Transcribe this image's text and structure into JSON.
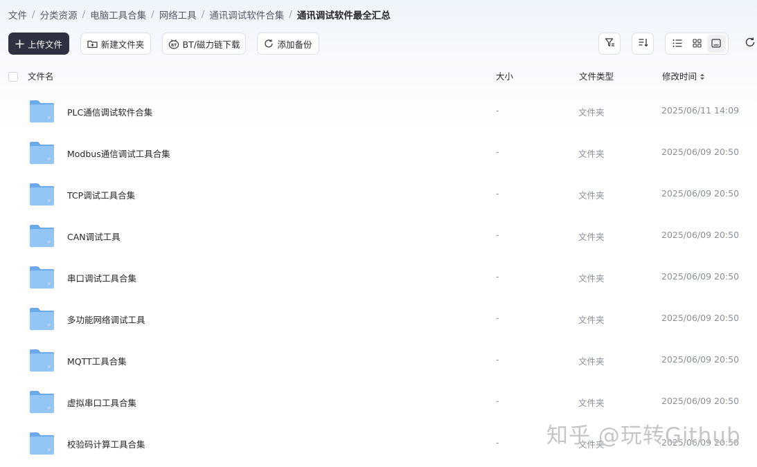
{
  "breadcrumb": [
    "文件",
    "分类资源",
    "电脑工具合集",
    "网络工具",
    "通讯调试软件合集",
    "通讯调试软件最全汇总"
  ],
  "toolbar": {
    "upload_label": "上传文件",
    "new_folder_label": "新建文件夹",
    "bt_label": "BT/磁力链下载",
    "backup_label": "添加备份",
    "icons": [
      "plus-icon",
      "new-folder-icon",
      "bt-icon",
      "sync-icon",
      "filter-icon",
      "sort-icon",
      "list-view-icon",
      "grid-view-icon",
      "thumbnail-view-icon",
      "refresh-icon"
    ]
  },
  "table": {
    "headers": {
      "name": "文件名",
      "size": "大小",
      "type": "文件类型",
      "time": "修改时间"
    },
    "rows": [
      {
        "name": "PLC通信调试软件合集",
        "size": "-",
        "type": "文件夹",
        "time": "2025/06/11 14:09"
      },
      {
        "name": "Modbus通信调试工具合集",
        "size": "-",
        "type": "文件夹",
        "time": "2025/06/09 20:50"
      },
      {
        "name": "TCP调试工具合集",
        "size": "-",
        "type": "文件夹",
        "time": "2025/06/09 20:50"
      },
      {
        "name": "CAN调试工具",
        "size": "-",
        "type": "文件夹",
        "time": "2025/06/09 20:50"
      },
      {
        "name": "串口调试工具合集",
        "size": "-",
        "type": "文件夹",
        "time": "2025/06/09 20:50"
      },
      {
        "name": "多功能网络调试工具",
        "size": "-",
        "type": "文件夹",
        "time": "2025/06/09 20:50"
      },
      {
        "name": "MQTT工具合集",
        "size": "-",
        "type": "文件夹",
        "time": "2025/06/09 20:50"
      },
      {
        "name": "虚拟串口工具合集",
        "size": "-",
        "type": "文件夹",
        "time": "2025/06/09 20:50"
      },
      {
        "name": "校验码计算工具合集",
        "size": "-",
        "type": "文件夹",
        "time": "2025/06/09 20:50"
      }
    ]
  },
  "watermark": "知乎 @玩转Github",
  "colors": {
    "primary_button": "#2e3140",
    "folder": "#7fb6f0",
    "muted_text": "#8a8f99"
  }
}
